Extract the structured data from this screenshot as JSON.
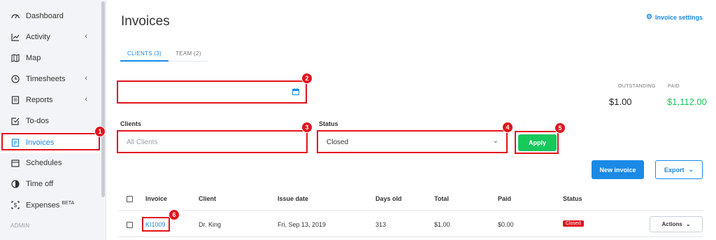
{
  "sidebar": {
    "items": [
      {
        "label": "Dashboard",
        "icon": "dashboard-icon"
      },
      {
        "label": "Activity",
        "icon": "activity-chart-icon",
        "chevron": "‹"
      },
      {
        "label": "Map",
        "icon": "map-icon"
      },
      {
        "label": "Timesheets",
        "icon": "clock-icon",
        "chevron": "‹"
      },
      {
        "label": "Reports",
        "icon": "report-icon",
        "chevron": "‹"
      },
      {
        "label": "To-dos",
        "icon": "checkbox-icon"
      },
      {
        "label": "Invoices",
        "icon": "invoice-icon"
      },
      {
        "label": "Schedules",
        "icon": "calendar-icon"
      },
      {
        "label": "Time off",
        "icon": "time-off-icon"
      },
      {
        "label": "Expenses",
        "icon": "expenses-icon",
        "superscript": "BETA"
      }
    ],
    "section_admin": "ADMIN"
  },
  "header": {
    "title": "Invoices",
    "settings_link": "Invoice settings"
  },
  "tabs": [
    {
      "label": "CLIENTS (3)",
      "active": true
    },
    {
      "label": "TEAM (2)",
      "active": false
    }
  ],
  "summary": {
    "outstanding_label": "OUTSTANDING",
    "outstanding_value": "$1.00",
    "paid_label": "PAID",
    "paid_value": "$1,112.00"
  },
  "filters": {
    "date_value": "",
    "clients_label": "Clients",
    "clients_placeholder": "All Clients",
    "status_label": "Status",
    "status_value": "Closed",
    "apply_label": "Apply"
  },
  "actions": {
    "new_invoice": "New invoice",
    "export": "Export"
  },
  "table": {
    "columns": [
      "Invoice",
      "Client",
      "Issue date",
      "Days old",
      "Total",
      "Paid",
      "Status"
    ],
    "rows": [
      {
        "invoice": "KI1009",
        "client": "Dr. King",
        "issue_date": "Fri, Sep 13, 2019",
        "days_old": "313",
        "total": "$1.00",
        "paid": "$0.00",
        "status": "Closed",
        "actions": "Actions"
      }
    ]
  },
  "annotations": [
    "1",
    "2",
    "3",
    "4",
    "5",
    "6"
  ],
  "colors": {
    "accent": "#1a8ae6",
    "success": "#17c95a",
    "danger": "#e0141e",
    "paid_text": "#17c95a"
  }
}
